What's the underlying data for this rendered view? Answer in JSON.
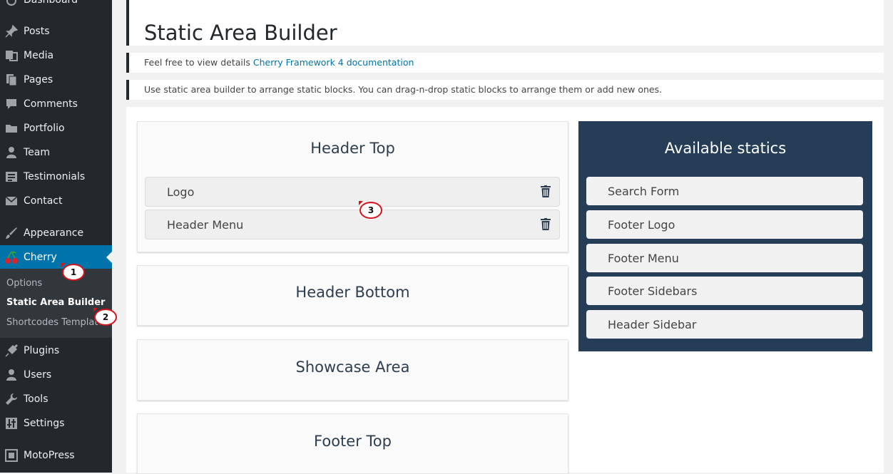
{
  "sidebar": {
    "items": [
      {
        "label": "Dashboard",
        "icon": "dashboard-icon"
      },
      {
        "label": "Posts",
        "icon": "pin-icon"
      },
      {
        "label": "Media",
        "icon": "media-icon"
      },
      {
        "label": "Pages",
        "icon": "pages-icon"
      },
      {
        "label": "Comments",
        "icon": "comment-icon"
      },
      {
        "label": "Portfolio",
        "icon": "folder-icon"
      },
      {
        "label": "Team",
        "icon": "person-icon"
      },
      {
        "label": "Testimonials",
        "icon": "list-icon"
      },
      {
        "label": "Contact",
        "icon": "envelope-icon"
      },
      {
        "label": "Appearance",
        "icon": "brush-icon"
      },
      {
        "label": "Cherry",
        "icon": "cherry-icon"
      },
      {
        "label": "Plugins",
        "icon": "plug-icon"
      },
      {
        "label": "Users",
        "icon": "user-icon"
      },
      {
        "label": "Tools",
        "icon": "wrench-icon"
      },
      {
        "label": "Settings",
        "icon": "sliders-icon"
      },
      {
        "label": "MotoPress",
        "icon": "motopress-icon"
      }
    ],
    "submenu": [
      "Options",
      "Static Area Builder",
      "Shortcodes Templater"
    ],
    "active_color": "#0073aa"
  },
  "callouts": [
    "1",
    "2",
    "3"
  ],
  "page": {
    "title": "Static Area Builder",
    "notice1_prefix": "Feel free to view details ",
    "notice1_link": "Cherry Framework 4 documentation",
    "notice2": "Use static area builder to arrange static blocks. You can drag-n-drop static blocks to arrange them or add new ones."
  },
  "areas": [
    {
      "title": "Header Top",
      "items": [
        "Logo",
        "Header Menu"
      ]
    },
    {
      "title": "Header Bottom",
      "items": []
    },
    {
      "title": "Showcase Area",
      "items": []
    },
    {
      "title": "Footer Top",
      "items": []
    }
  ],
  "available": {
    "title": "Available statics",
    "items": [
      "Search Form",
      "Footer Logo",
      "Footer Menu",
      "Footer Sidebars",
      "Header Sidebar"
    ],
    "color": "#253d57"
  }
}
